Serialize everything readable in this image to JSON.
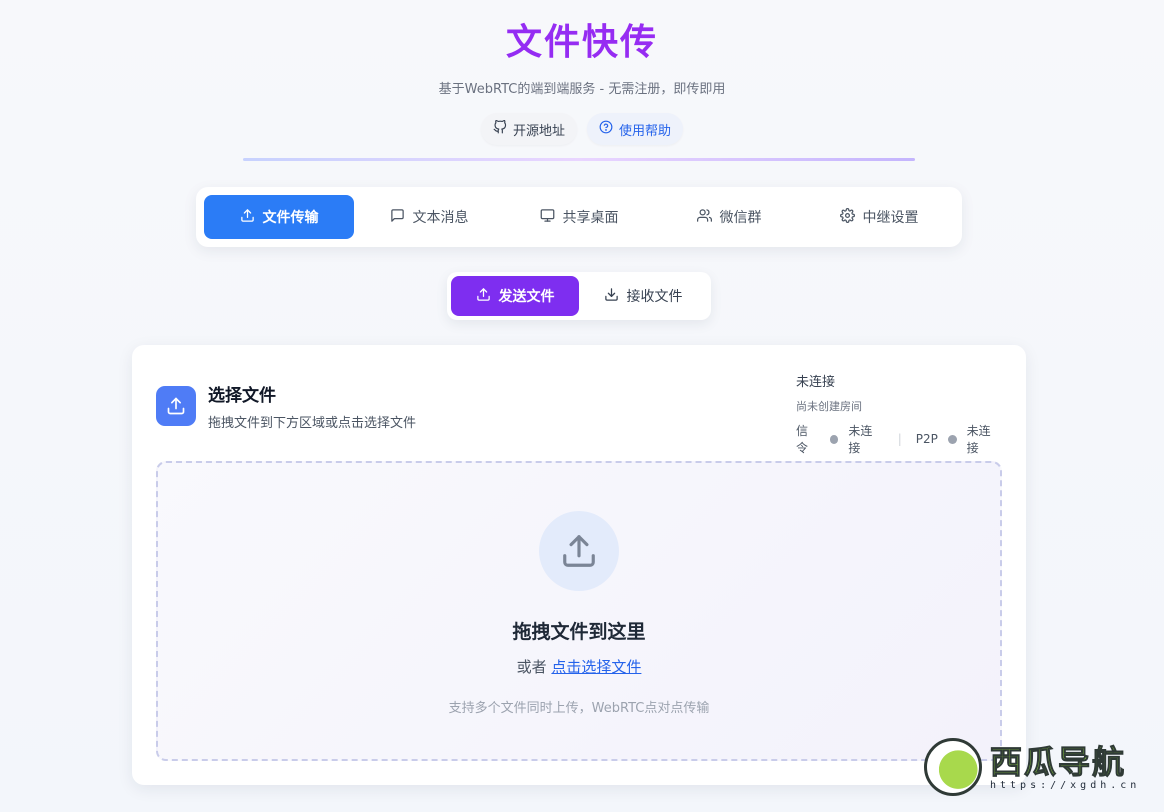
{
  "header": {
    "title": "文件快传",
    "subtitle": "基于WebRTC的端到端服务 - 无需注册，即传即用",
    "links": [
      {
        "label": "开源地址",
        "icon": "github-icon"
      },
      {
        "label": "使用帮助",
        "icon": "help-circle-icon"
      }
    ]
  },
  "tabs": [
    {
      "label": "文件传输",
      "icon": "upload-icon",
      "active": true
    },
    {
      "label": "文本消息",
      "icon": "message-icon",
      "active": false
    },
    {
      "label": "共享桌面",
      "icon": "monitor-icon",
      "active": false
    },
    {
      "label": "微信群",
      "icon": "users-icon",
      "active": false
    },
    {
      "label": "中继设置",
      "icon": "gear-icon",
      "active": false
    }
  ],
  "subtabs": [
    {
      "label": "发送文件",
      "icon": "upload-icon",
      "active": true
    },
    {
      "label": "接收文件",
      "icon": "download-icon",
      "active": false
    }
  ],
  "card": {
    "title": "选择文件",
    "desc": "拖拽文件到下方区域或点击选择文件",
    "status": {
      "main": "未连接",
      "room": "尚未创建房间",
      "signal_label": "信令",
      "signal_status": "未连接",
      "p2p_label": "P2P",
      "p2p_status": "未连接"
    },
    "drop": {
      "title": "拖拽文件到这里",
      "or": "或者",
      "link": "点击选择文件",
      "note": "支持多个文件同时上传，WebRTC点对点传输"
    }
  },
  "watermark": {
    "name": "西瓜导航",
    "url": "https://xgdh.cn"
  },
  "colors": {
    "accent_blue": "#2b7cf6",
    "accent_purple": "#7e2ef0",
    "title_purple": "#8b2cf5",
    "status_dot": "#9ca3af"
  }
}
